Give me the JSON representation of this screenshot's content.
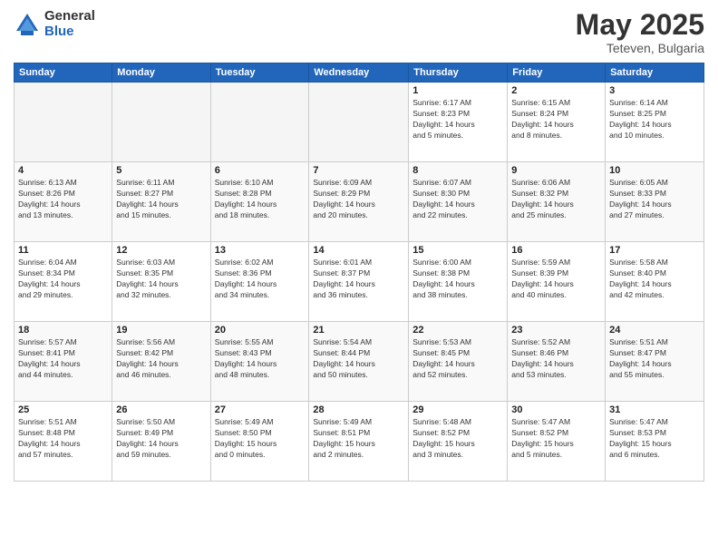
{
  "logo": {
    "general": "General",
    "blue": "Blue"
  },
  "title": {
    "month": "May 2025",
    "location": "Teteven, Bulgaria"
  },
  "days_header": [
    "Sunday",
    "Monday",
    "Tuesday",
    "Wednesday",
    "Thursday",
    "Friday",
    "Saturday"
  ],
  "weeks": [
    [
      {
        "day": "",
        "info": ""
      },
      {
        "day": "",
        "info": ""
      },
      {
        "day": "",
        "info": ""
      },
      {
        "day": "",
        "info": ""
      },
      {
        "day": "1",
        "info": "Sunrise: 6:17 AM\nSunset: 8:23 PM\nDaylight: 14 hours\nand 5 minutes."
      },
      {
        "day": "2",
        "info": "Sunrise: 6:15 AM\nSunset: 8:24 PM\nDaylight: 14 hours\nand 8 minutes."
      },
      {
        "day": "3",
        "info": "Sunrise: 6:14 AM\nSunset: 8:25 PM\nDaylight: 14 hours\nand 10 minutes."
      }
    ],
    [
      {
        "day": "4",
        "info": "Sunrise: 6:13 AM\nSunset: 8:26 PM\nDaylight: 14 hours\nand 13 minutes."
      },
      {
        "day": "5",
        "info": "Sunrise: 6:11 AM\nSunset: 8:27 PM\nDaylight: 14 hours\nand 15 minutes."
      },
      {
        "day": "6",
        "info": "Sunrise: 6:10 AM\nSunset: 8:28 PM\nDaylight: 14 hours\nand 18 minutes."
      },
      {
        "day": "7",
        "info": "Sunrise: 6:09 AM\nSunset: 8:29 PM\nDaylight: 14 hours\nand 20 minutes."
      },
      {
        "day": "8",
        "info": "Sunrise: 6:07 AM\nSunset: 8:30 PM\nDaylight: 14 hours\nand 22 minutes."
      },
      {
        "day": "9",
        "info": "Sunrise: 6:06 AM\nSunset: 8:32 PM\nDaylight: 14 hours\nand 25 minutes."
      },
      {
        "day": "10",
        "info": "Sunrise: 6:05 AM\nSunset: 8:33 PM\nDaylight: 14 hours\nand 27 minutes."
      }
    ],
    [
      {
        "day": "11",
        "info": "Sunrise: 6:04 AM\nSunset: 8:34 PM\nDaylight: 14 hours\nand 29 minutes."
      },
      {
        "day": "12",
        "info": "Sunrise: 6:03 AM\nSunset: 8:35 PM\nDaylight: 14 hours\nand 32 minutes."
      },
      {
        "day": "13",
        "info": "Sunrise: 6:02 AM\nSunset: 8:36 PM\nDaylight: 14 hours\nand 34 minutes."
      },
      {
        "day": "14",
        "info": "Sunrise: 6:01 AM\nSunset: 8:37 PM\nDaylight: 14 hours\nand 36 minutes."
      },
      {
        "day": "15",
        "info": "Sunrise: 6:00 AM\nSunset: 8:38 PM\nDaylight: 14 hours\nand 38 minutes."
      },
      {
        "day": "16",
        "info": "Sunrise: 5:59 AM\nSunset: 8:39 PM\nDaylight: 14 hours\nand 40 minutes."
      },
      {
        "day": "17",
        "info": "Sunrise: 5:58 AM\nSunset: 8:40 PM\nDaylight: 14 hours\nand 42 minutes."
      }
    ],
    [
      {
        "day": "18",
        "info": "Sunrise: 5:57 AM\nSunset: 8:41 PM\nDaylight: 14 hours\nand 44 minutes."
      },
      {
        "day": "19",
        "info": "Sunrise: 5:56 AM\nSunset: 8:42 PM\nDaylight: 14 hours\nand 46 minutes."
      },
      {
        "day": "20",
        "info": "Sunrise: 5:55 AM\nSunset: 8:43 PM\nDaylight: 14 hours\nand 48 minutes."
      },
      {
        "day": "21",
        "info": "Sunrise: 5:54 AM\nSunset: 8:44 PM\nDaylight: 14 hours\nand 50 minutes."
      },
      {
        "day": "22",
        "info": "Sunrise: 5:53 AM\nSunset: 8:45 PM\nDaylight: 14 hours\nand 52 minutes."
      },
      {
        "day": "23",
        "info": "Sunrise: 5:52 AM\nSunset: 8:46 PM\nDaylight: 14 hours\nand 53 minutes."
      },
      {
        "day": "24",
        "info": "Sunrise: 5:51 AM\nSunset: 8:47 PM\nDaylight: 14 hours\nand 55 minutes."
      }
    ],
    [
      {
        "day": "25",
        "info": "Sunrise: 5:51 AM\nSunset: 8:48 PM\nDaylight: 14 hours\nand 57 minutes."
      },
      {
        "day": "26",
        "info": "Sunrise: 5:50 AM\nSunset: 8:49 PM\nDaylight: 14 hours\nand 59 minutes."
      },
      {
        "day": "27",
        "info": "Sunrise: 5:49 AM\nSunset: 8:50 PM\nDaylight: 15 hours\nand 0 minutes."
      },
      {
        "day": "28",
        "info": "Sunrise: 5:49 AM\nSunset: 8:51 PM\nDaylight: 15 hours\nand 2 minutes."
      },
      {
        "day": "29",
        "info": "Sunrise: 5:48 AM\nSunset: 8:52 PM\nDaylight: 15 hours\nand 3 minutes."
      },
      {
        "day": "30",
        "info": "Sunrise: 5:47 AM\nSunset: 8:52 PM\nDaylight: 15 hours\nand 5 minutes."
      },
      {
        "day": "31",
        "info": "Sunrise: 5:47 AM\nSunset: 8:53 PM\nDaylight: 15 hours\nand 6 minutes."
      }
    ]
  ]
}
